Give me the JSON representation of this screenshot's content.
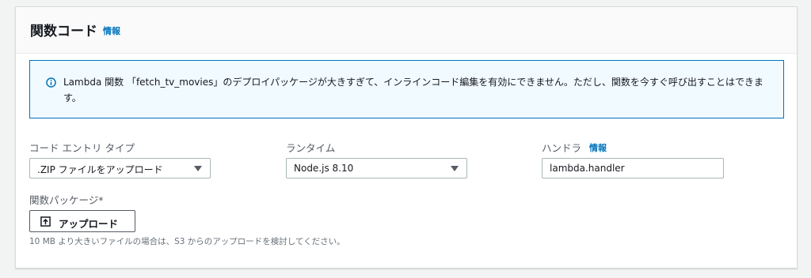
{
  "panel": {
    "title": "関数コード",
    "info_link": "情報"
  },
  "alert": {
    "icon": "info-circle-icon",
    "color": "#0073bb",
    "message": "Lambda 関数 「fetch_tv_movies」のデプロイパッケージが大きすぎて、インラインコード編集を有効にできません。ただし、関数を今すぐ呼び出すことはできます。"
  },
  "code_entry_type": {
    "label": "コード エントリ タイプ",
    "selected": ".ZIP ファイルをアップロード"
  },
  "runtime": {
    "label": "ランタイム",
    "selected": "Node.js 8.10"
  },
  "handler": {
    "label": "ハンドラ",
    "info_link": "情報",
    "value": "lambda.handler"
  },
  "package": {
    "label": "関数パッケージ*",
    "upload_button": "アップロード",
    "hint": "10 MB より大きいファイルの場合は、S3 からのアップロードを検討してください。"
  },
  "colors": {
    "link": "#0073bb",
    "alert_bg": "#f1faff",
    "border": "#aab7b8"
  }
}
